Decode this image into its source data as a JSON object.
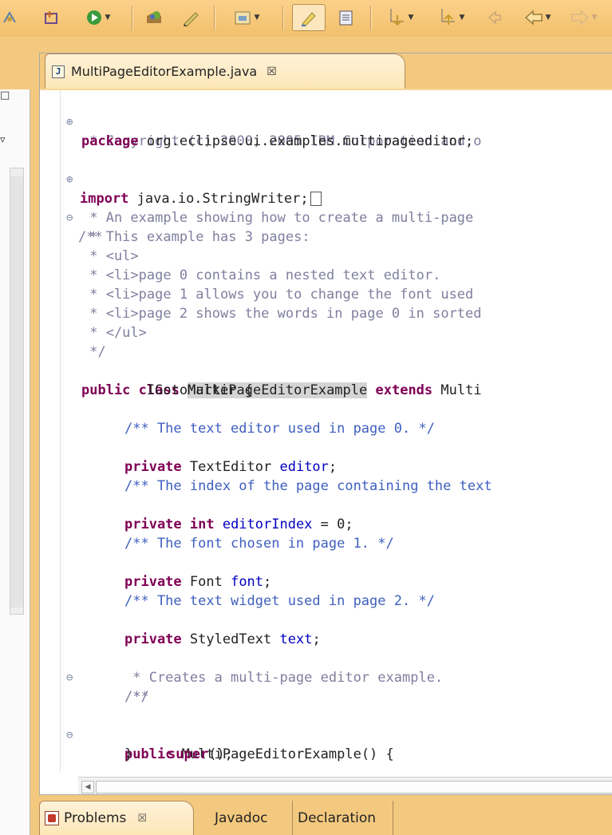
{
  "toolbar": {
    "items": [
      {
        "name": "build-icon"
      },
      {
        "name": "new-class-icon"
      },
      {
        "name": "run-icon"
      },
      {
        "name": "open-type-icon"
      },
      {
        "name": "edit-icon"
      },
      {
        "name": "open-perspective-icon"
      },
      {
        "name": "toggle-mark-occurrences-icon"
      },
      {
        "name": "show-source-icon"
      },
      {
        "name": "next-annotation-icon"
      },
      {
        "name": "previous-annotation-icon"
      },
      {
        "name": "last-edit-icon"
      },
      {
        "name": "back-icon"
      },
      {
        "name": "forward-icon"
      }
    ]
  },
  "left_panel": {
    "minimize_label": "□",
    "maximize_label": "▿"
  },
  "editor": {
    "tab_icon": "J",
    "tab_title": "MultiPageEditorExample.java",
    "tab_close": "☒",
    "lines": {
      "l1": " * Copyright (c) 2000, 2005 IBM Corporation and o",
      "l2_kw": "package",
      "l2_rest": " org.eclipse.ui.examples.multipageeditor;",
      "l3_kw": "import",
      "l3_rest": " java.io.StringWriter;",
      "l4": "/**",
      "l5": " * An example showing how to create a multi-page ",
      "l6": " * This example has 3 pages:",
      "l7": " * <ul>",
      "l8": " * <li>page 0 contains a nested text editor.",
      "l9": " * <li>page 1 allows you to change the font used ",
      "l10": " * <li>page 2 shows the words in page 0 in sorted",
      "l11": " * </ul>",
      "l12": " */",
      "l13_kw1": "public class",
      "l13_name": "MultiPageEditorExample",
      "l13_kw2": "extends",
      "l13_rest": " Multi",
      "l14": "        IGotoMarker {",
      "l15": "/** The text editor used in page 0. */",
      "l16_kw": "private",
      "l16_type": " TextEditor ",
      "l16_id": "editor",
      "l16_end": ";",
      "l17": "/** The index of the page containing the text",
      "l18_kw": "private int",
      "l18_id": " editorIndex",
      "l18_end": " = 0;",
      "l19": "/** The font chosen in page 1. */",
      "l20_kw": "private",
      "l20_type": " Font ",
      "l20_id": "font",
      "l20_end": ";",
      "l21": "/** The text widget used in page 2. */",
      "l22_kw": "private",
      "l22_type": " StyledText ",
      "l22_id": "text",
      "l22_end": ";",
      "l23": "/**",
      "l24": " * Creates a multi-page editor example.",
      "l25": " */",
      "l26_kw": "public",
      "l26_rest": " MultiPageEditorExample() {",
      "l27_kw": "super",
      "l27_rest": "();",
      "l28": "}"
    },
    "fold_markers": {
      "expand": "⊕",
      "collapse": "⊖"
    }
  },
  "bottom_tabs": {
    "problems": "Problems",
    "problems_close": "☒",
    "javadoc": "Javadoc",
    "declaration": "Declaration"
  },
  "colors": {
    "keyword": "#7f0055",
    "comment": "#3f5fbf",
    "javadoc": "#7f7f9f",
    "field": "#0000c0",
    "chrome": "#f3c97f"
  }
}
